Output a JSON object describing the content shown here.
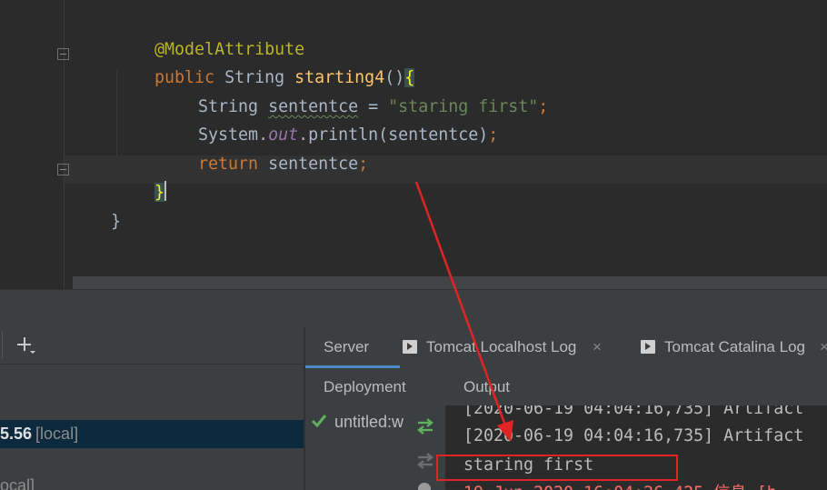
{
  "editor": {
    "lines": {
      "annotation": "@ModelAttribute",
      "sig_kw": "public",
      "sig_type": " String ",
      "sig_fn": "starting4",
      "sig_paren": "()",
      "sig_brace": "{",
      "l3_type": "String ",
      "l3_var": "sententce",
      "l3_eq": " = ",
      "l3_str": "\"staring first\"",
      "l3_semi": ";",
      "l4_a": "System.",
      "l4_out": "out",
      "l4_b": ".println(sententce)",
      "l4_semi": ";",
      "l5_kw": "return",
      "l5_rest": " sententce",
      "l5_semi": ";",
      "l6_brace": "}",
      "l7_brace": "}"
    }
  },
  "toolwindow": {
    "left": {
      "server_version": "5.56",
      "server_local": "[local]",
      "server2_text": "ocal]"
    },
    "tabs": [
      {
        "label": "Server"
      },
      {
        "label": "Tomcat Localhost Log"
      },
      {
        "label": "Tomcat Catalina Log"
      }
    ],
    "close_glyph": "×",
    "deployment_header": "Deployment",
    "output_header": "Output",
    "deployment_item": "untitled:w",
    "log": [
      "[2020-06-19 04:04:16,735] Artifact",
      "[2020-06-19 04:04:16,735] Artifact",
      "staring first",
      "19-Jun-2020 16:04:26.425 信息 [h"
    ]
  },
  "colors": {
    "editor_bg": "#2b2b2b",
    "panel_bg": "#3c3f41",
    "annotation_red": "#e02424",
    "selection": "#0d293e"
  }
}
